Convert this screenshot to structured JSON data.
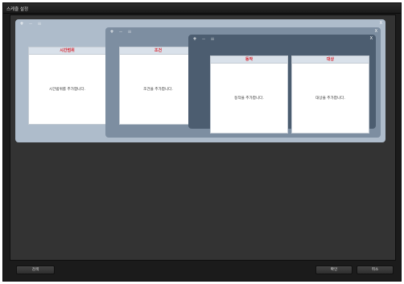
{
  "window": {
    "title": "스케쥴 설정"
  },
  "panels": {
    "outer": {
      "close_label": "X"
    },
    "middle": {
      "close_label": "X"
    },
    "inner": {
      "close_label": "X"
    }
  },
  "toolbar_icons": [
    "add-icon",
    "remove-icon",
    "settings-icon"
  ],
  "cards": {
    "time_range": {
      "header": "시간범위",
      "placeholder": "시간범위를 추가합니다."
    },
    "condition": {
      "header": "조건",
      "placeholder": "조건을 추가합니다."
    },
    "action": {
      "header": "동작",
      "placeholder": "동작을 추가합니다."
    },
    "target": {
      "header": "대상",
      "placeholder": "대상을 추가합니다."
    }
  },
  "footer": {
    "search_label": "검색",
    "ok_label": "확인",
    "cancel_label": "취소"
  },
  "colors": {
    "header_text": "#d8202b",
    "outer_panel": "#aebccb",
    "middle_panel": "#7d8ea1",
    "inner_panel": "#4c5d70",
    "workspace": "#333333"
  }
}
